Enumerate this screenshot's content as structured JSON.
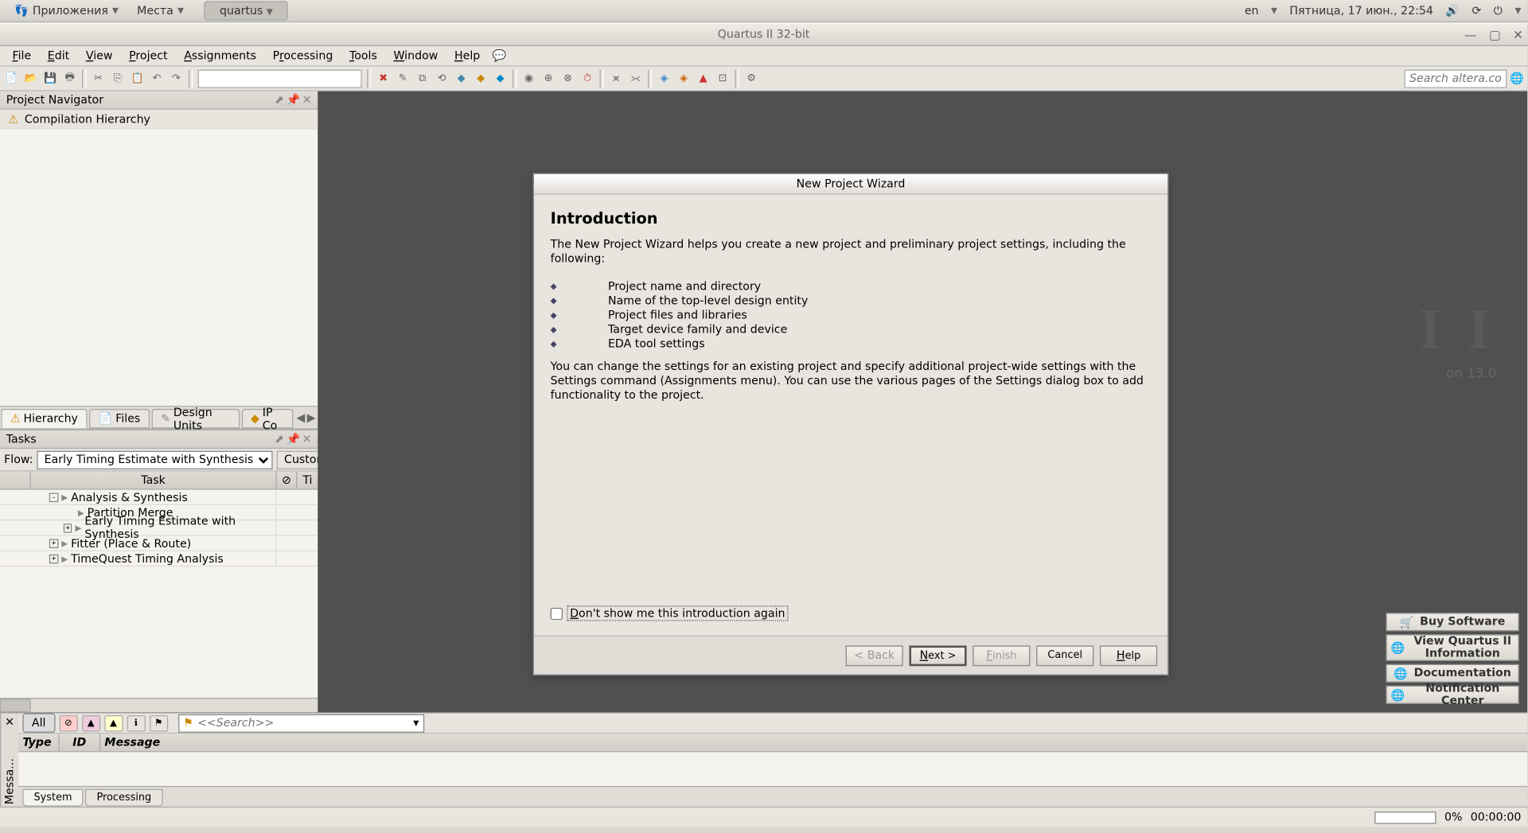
{
  "desktop": {
    "apps_menu": "Приложения",
    "places_menu": "Места",
    "task_button": "quartus",
    "lang": "en",
    "datetime": "Пятница, 17 июн., 22:54"
  },
  "window": {
    "title": "Quartus II 32-bit"
  },
  "menubar": {
    "file": "File",
    "edit": "Edit",
    "view": "View",
    "project": "Project",
    "assignments": "Assignments",
    "processing": "Processing",
    "tools": "Tools",
    "window": "Window",
    "help": "Help"
  },
  "search": {
    "placeholder": "Search altera.com"
  },
  "navigator": {
    "title": "Project Navigator",
    "item": "Compilation Hierarchy",
    "tabs": {
      "hierarchy": "Hierarchy",
      "files": "Files",
      "design_units": "Design Units",
      "ip": "IP Co"
    }
  },
  "tasks": {
    "title": "Tasks",
    "flow_label": "Flow:",
    "flow_value": "Early Timing Estimate with Synthesis",
    "customize": "Customize...",
    "col_task": "Task",
    "col_time_prefix": "Ti",
    "col_check": "⊘",
    "rows": [
      {
        "indent": 1,
        "expand": "-",
        "label": "Analysis & Synthesis"
      },
      {
        "indent": 2,
        "expand": "",
        "label": "Partition Merge"
      },
      {
        "indent": 2,
        "expand": "+",
        "label": "Early Timing Estimate with Synthesis"
      },
      {
        "indent": 1,
        "expand": "+",
        "label": "Fitter (Place & Route)"
      },
      {
        "indent": 1,
        "expand": "+",
        "label": "TimeQuest Timing Analysis"
      }
    ]
  },
  "workarea": {
    "logo_big": "I I",
    "logo_sub": "on 13.0",
    "links": {
      "buy": "Buy Software",
      "view": "View Quartus II Information",
      "docs": "Documentation",
      "notif": "Notification Center"
    }
  },
  "wizard": {
    "title": "New Project Wizard",
    "heading": "Introduction",
    "intro": "The New Project Wizard helps you create a new project and preliminary project settings, including the following:",
    "bullets": [
      "Project name and directory",
      "Name of the top-level design entity",
      "Project files and libraries",
      "Target device family and device",
      "EDA tool settings"
    ],
    "para2": "You can change the settings for an existing project and specify additional project-wide settings with the Settings command (Assignments menu). You can use the various pages of the Settings dialog box to add functionality to the project.",
    "checkbox": "Don't show me this introduction again",
    "buttons": {
      "back": "< Back",
      "next": "Next >",
      "finish": "Finish",
      "cancel": "Cancel",
      "help": "Help"
    }
  },
  "messages": {
    "side_label": "Messa...",
    "all": "All",
    "search_placeholder": "<<Search>>",
    "cols": {
      "type": "Type",
      "id": "ID",
      "message": "Message"
    },
    "tabs": {
      "system": "System",
      "processing": "Processing"
    }
  },
  "statusbar": {
    "percent": "0%",
    "time": "00:00:00"
  }
}
